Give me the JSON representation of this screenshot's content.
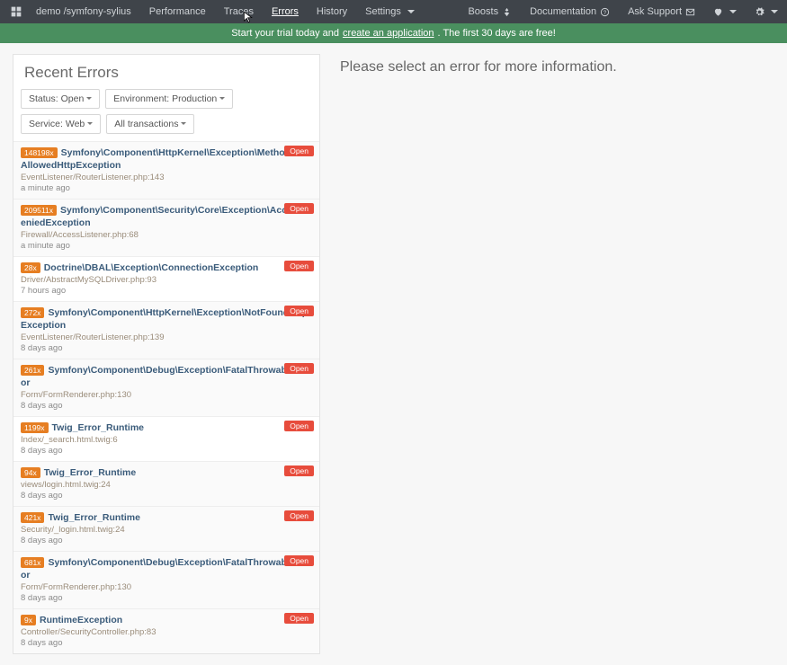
{
  "nav": {
    "crumb": "demo /symfony-sylius",
    "items": [
      "Performance",
      "Traces",
      "Errors",
      "History",
      "Settings"
    ],
    "active": 2,
    "right": {
      "boosts": "Boosts",
      "docs": "Documentation",
      "support": "Ask Support"
    }
  },
  "banner": {
    "pre": "Start your trial today and ",
    "link": "create an application",
    "post": ". The first 30 days are free!"
  },
  "panel": {
    "title": "Recent Errors",
    "filters": {
      "status": "Status: Open",
      "env": "Environment: Production",
      "service": "Service: Web",
      "tx": "All transactions"
    }
  },
  "errors": [
    {
      "count": "148198x",
      "title": "Symfony\\Component\\HttpKernel\\Exception\\MethodNotAllowedHttpException",
      "src": "EventListener/RouterListener.php:143",
      "ago": "a minute ago",
      "status": "Open",
      "hl": true
    },
    {
      "count": "209511x",
      "title": "Symfony\\Component\\Security\\Core\\Exception\\AccessDeniedException",
      "src": "Firewall/AccessListener.php:68",
      "ago": "a minute ago",
      "status": "Open",
      "hl": true
    },
    {
      "count": "28x",
      "title": "Doctrine\\DBAL\\Exception\\ConnectionException",
      "src": "Driver/AbstractMySQLDriver.php:93",
      "ago": "7 hours ago",
      "status": "Open"
    },
    {
      "count": "272x",
      "title": "Symfony\\Component\\HttpKernel\\Exception\\NotFoundHttpException",
      "src": "EventListener/RouterListener.php:139",
      "ago": "8 days ago",
      "status": "Open",
      "hl": true
    },
    {
      "count": "261x",
      "title": "Symfony\\Component\\Debug\\Exception\\FatalThrowableError",
      "src": "Form/FormRenderer.php:130",
      "ago": "8 days ago",
      "status": "Open",
      "hl": true
    },
    {
      "count": "1199x",
      "title": "Twig_Error_Runtime",
      "src": "Index/_search.html.twig:6",
      "ago": "8 days ago",
      "status": "Open"
    },
    {
      "count": "94x",
      "title": "Twig_Error_Runtime",
      "src": "views/login.html.twig:24",
      "ago": "8 days ago",
      "status": "Open",
      "hl": true
    },
    {
      "count": "421x",
      "title": "Twig_Error_Runtime",
      "src": "Security/_login.html.twig:24",
      "ago": "8 days ago",
      "status": "Open",
      "hl": true
    },
    {
      "count": "681x",
      "title": "Symfony\\Component\\Debug\\Exception\\FatalThrowableError",
      "src": "Form/FormRenderer.php:130",
      "ago": "8 days ago",
      "status": "Open",
      "hl": true
    },
    {
      "count": "9x",
      "title": "RuntimeException",
      "src": "Controller/SecurityController.php:83",
      "ago": "8 days ago",
      "status": "Open",
      "hl": true
    }
  ],
  "detail": {
    "message": "Please select an error for more information."
  }
}
